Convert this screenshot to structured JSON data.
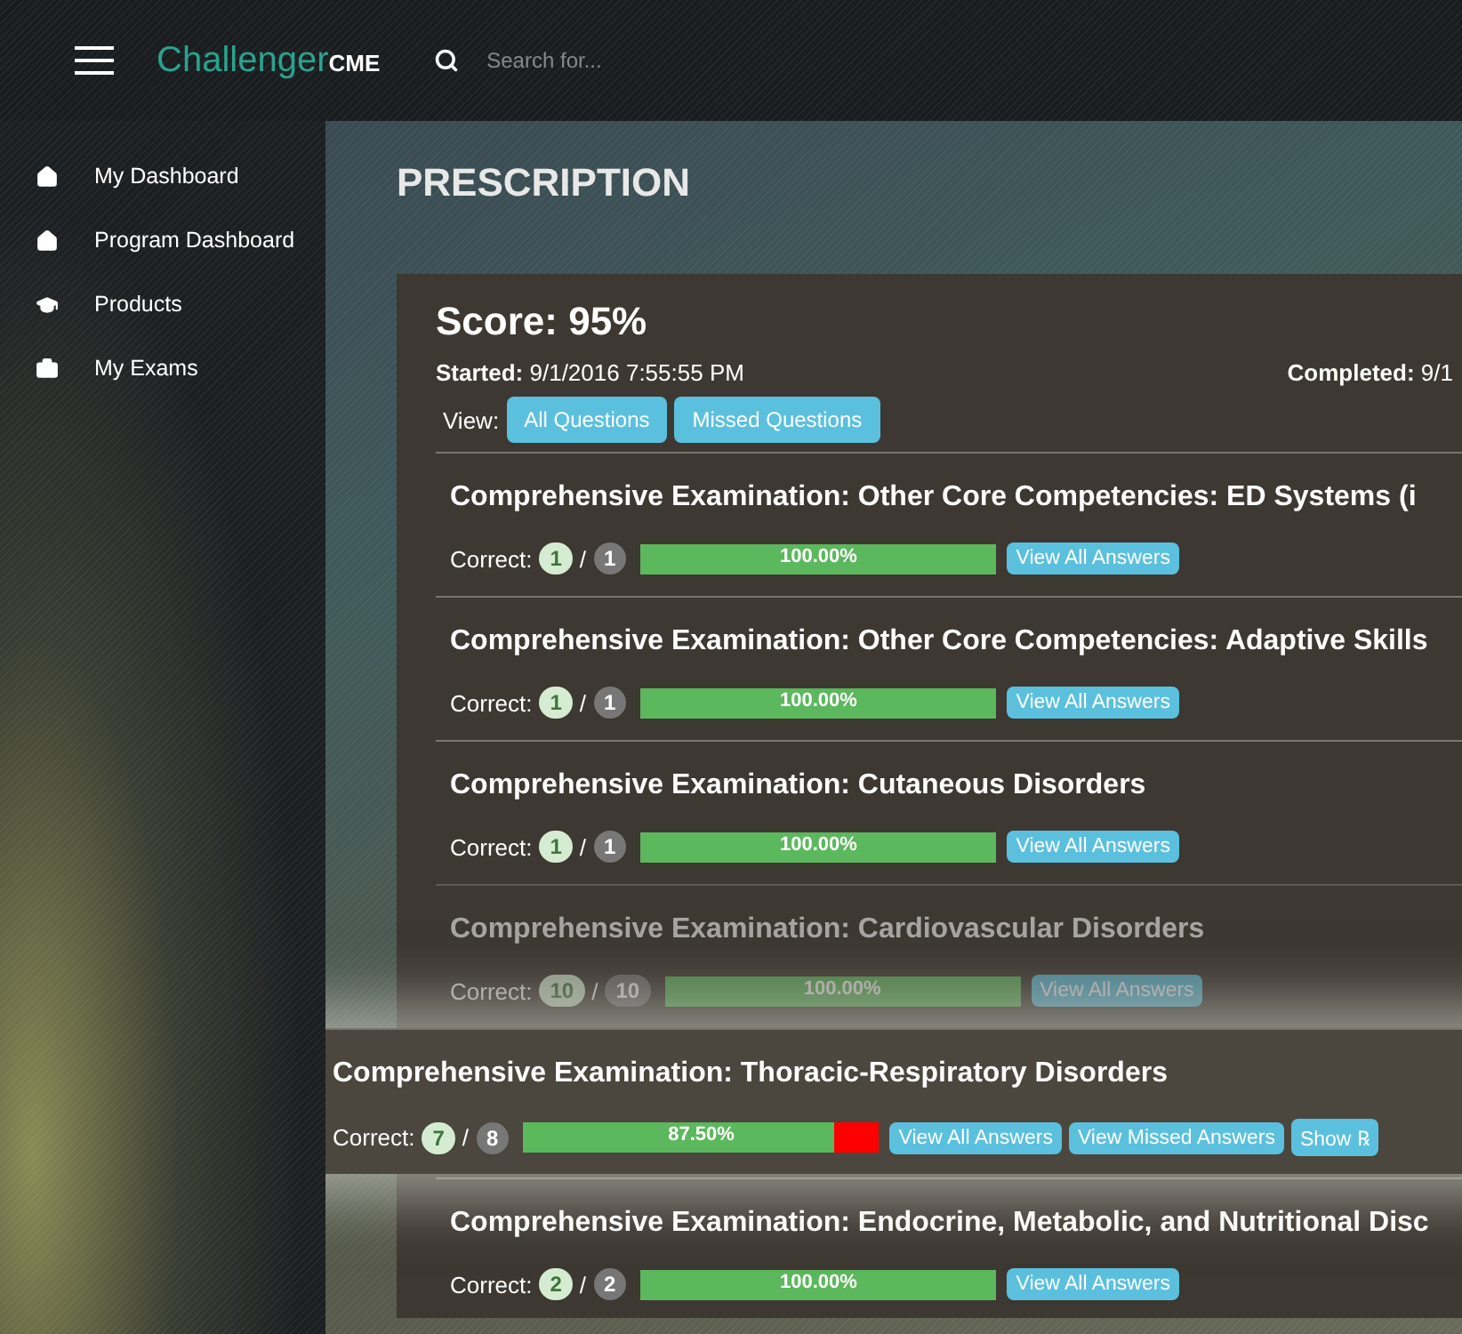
{
  "header": {
    "brand_main": "Challenger",
    "brand_suffix": "CME",
    "search": {
      "placeholder": "Search for..."
    }
  },
  "sidebar": {
    "items": [
      {
        "kind": "home",
        "label": "My Dashboard"
      },
      {
        "kind": "home",
        "label": "Program Dashboard"
      },
      {
        "kind": "cap",
        "label": "Products"
      },
      {
        "kind": "briefcase",
        "label": "My Exams"
      }
    ]
  },
  "page_title": "PRESCRIPTION",
  "result": {
    "score": "Score: 95%",
    "started_label": "Started:",
    "started": "9/1/2016 7:55:55 PM",
    "completed_label": "Completed:",
    "completed": "9/1",
    "view_label": "View:",
    "view_buttons": [
      "All Questions",
      "Missed Questions"
    ],
    "sections": [
      {
        "title": "Comprehensive Examination: Other Core Competencies: ED Systems (i",
        "correct_label": "Correct:",
        "correct": "1",
        "separator": "/",
        "total": "1",
        "level": 1,
        "percent": "100.00%",
        "buttons": [
          "View All Answers"
        ],
        "dimmed": false,
        "highlighted": false
      },
      {
        "title": "Comprehensive Examination: Other Core Competencies: Adaptive Skills",
        "correct_label": "Correct:",
        "correct": "1",
        "separator": "/",
        "total": "1",
        "level": 1,
        "percent": "100.00%",
        "buttons": [
          "View All Answers"
        ],
        "dimmed": false,
        "highlighted": false
      },
      {
        "title": "Comprehensive Examination: Cutaneous Disorders",
        "correct_label": "Correct:",
        "correct": "1",
        "separator": "/",
        "total": "1",
        "level": 1,
        "percent": "100.00%",
        "buttons": [
          "View All Answers"
        ],
        "dimmed": false,
        "highlighted": false
      },
      {
        "title": "Comprehensive Examination: Cardiovascular Disorders",
        "correct_label": "Correct:",
        "correct": "10",
        "separator": "/",
        "total": "10",
        "level": 1,
        "percent": "100.00%",
        "buttons": [
          "View All Answers"
        ],
        "dimmed": true,
        "highlighted": false
      },
      {
        "title": "Comprehensive Examination: Thoracic-Respiratory Disorders",
        "correct_label": "Correct:",
        "correct": "7",
        "separator": "/",
        "total": "8",
        "level": 0.875,
        "percent": "87.50%",
        "buttons": [
          "View All Answers",
          "View Missed Answers",
          "Show ℞"
        ],
        "dimmed": false,
        "highlighted": true
      },
      {
        "title": "Comprehensive Examination: Endocrine, Metabolic, and Nutritional Disc",
        "correct_label": "Correct:",
        "correct": "2",
        "separator": "/",
        "total": "2",
        "level": 1,
        "percent": "100.00%",
        "buttons": [
          "View All Answers"
        ],
        "dimmed": false,
        "highlighted": false
      }
    ]
  }
}
